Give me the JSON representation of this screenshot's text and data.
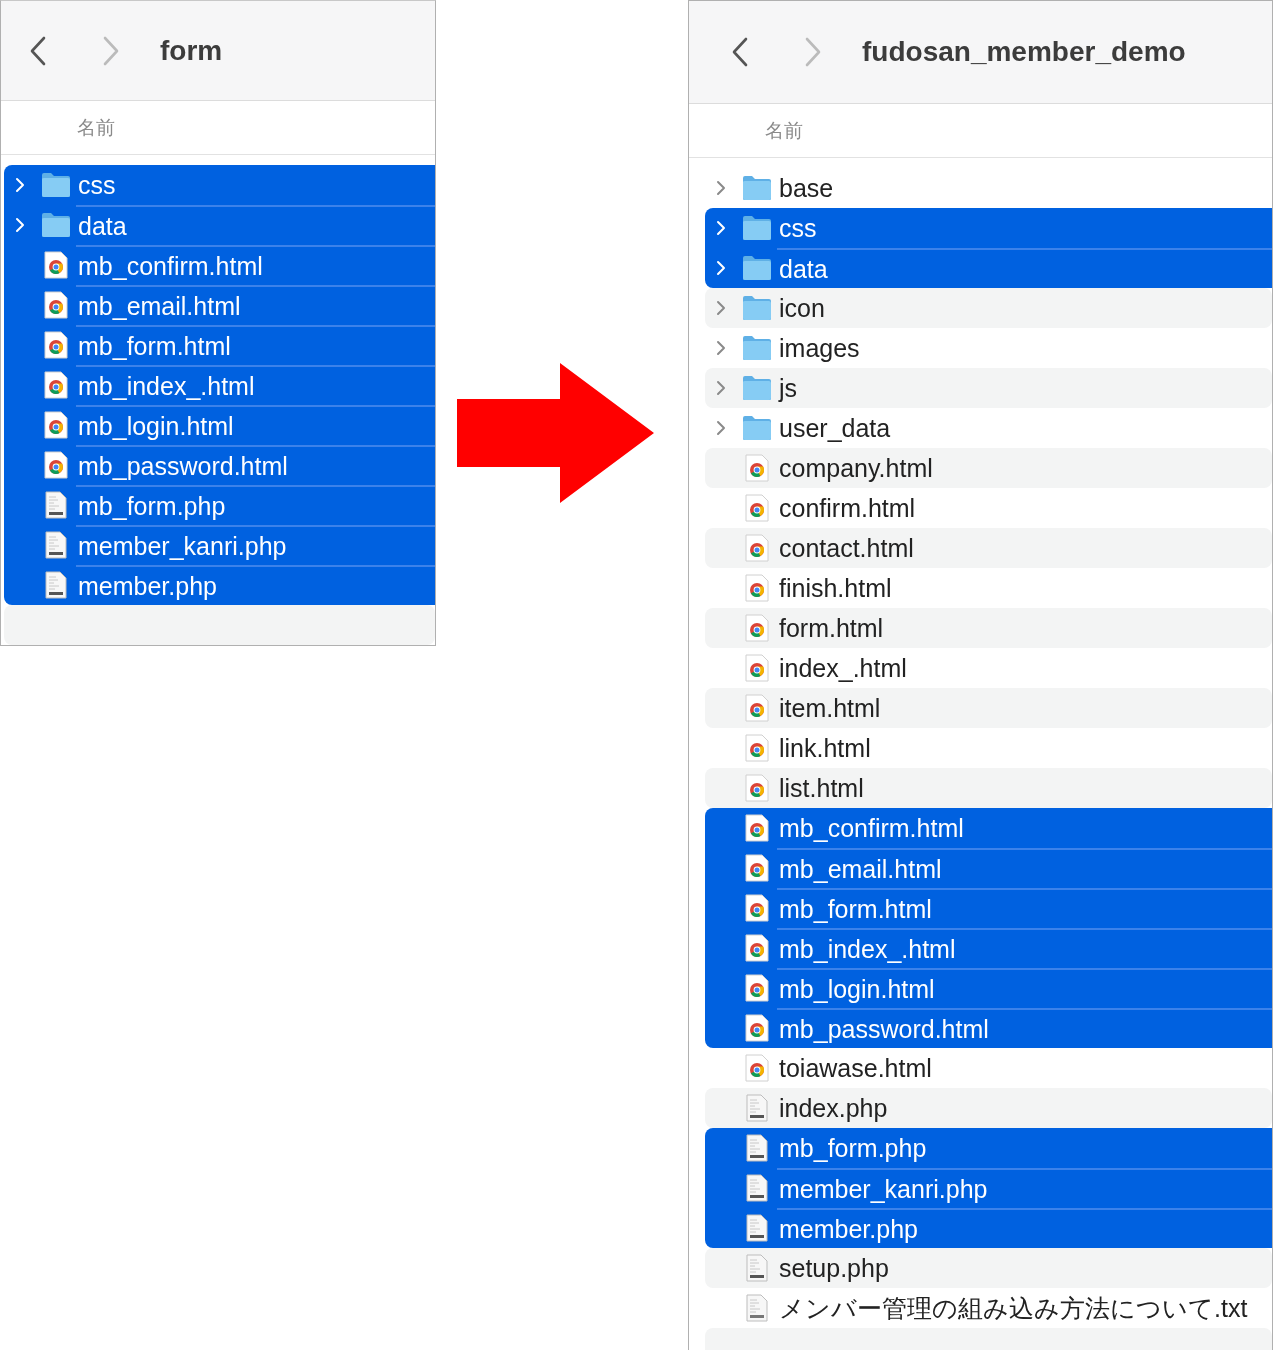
{
  "windows": [
    {
      "title": "form",
      "back_disabled": false,
      "forward_disabled": true,
      "column_header": "名前",
      "items": [
        {
          "name": "css",
          "kind": "folder",
          "selected": true
        },
        {
          "name": "data",
          "kind": "folder",
          "selected": true
        },
        {
          "name": "mb_confirm.html",
          "kind": "html",
          "selected": true
        },
        {
          "name": "mb_email.html",
          "kind": "html",
          "selected": true
        },
        {
          "name": "mb_form.html",
          "kind": "html",
          "selected": true
        },
        {
          "name": "mb_index_.html",
          "kind": "html",
          "selected": true
        },
        {
          "name": "mb_login.html",
          "kind": "html",
          "selected": true
        },
        {
          "name": "mb_password.html",
          "kind": "html",
          "selected": true
        },
        {
          "name": "mb_form.php",
          "kind": "php",
          "selected": true
        },
        {
          "name": "member_kanri.php",
          "kind": "php",
          "selected": true
        },
        {
          "name": "member.php",
          "kind": "php",
          "selected": true
        }
      ]
    },
    {
      "title": "fudosan_member_demo",
      "back_disabled": false,
      "forward_disabled": true,
      "column_header": "名前",
      "items": [
        {
          "name": "base",
          "kind": "folder",
          "selected": false
        },
        {
          "name": "css",
          "kind": "folder",
          "selected": true
        },
        {
          "name": "data",
          "kind": "folder",
          "selected": true
        },
        {
          "name": "icon",
          "kind": "folder",
          "selected": false
        },
        {
          "name": "images",
          "kind": "folder",
          "selected": false
        },
        {
          "name": "js",
          "kind": "folder",
          "selected": false
        },
        {
          "name": "user_data",
          "kind": "folder",
          "selected": false
        },
        {
          "name": "company.html",
          "kind": "html",
          "selected": false
        },
        {
          "name": "confirm.html",
          "kind": "html",
          "selected": false
        },
        {
          "name": "contact.html",
          "kind": "html",
          "selected": false
        },
        {
          "name": "finish.html",
          "kind": "html",
          "selected": false
        },
        {
          "name": "form.html",
          "kind": "html",
          "selected": false
        },
        {
          "name": "index_.html",
          "kind": "html",
          "selected": false
        },
        {
          "name": "item.html",
          "kind": "html",
          "selected": false
        },
        {
          "name": "link.html",
          "kind": "html",
          "selected": false
        },
        {
          "name": "list.html",
          "kind": "html",
          "selected": false
        },
        {
          "name": "mb_confirm.html",
          "kind": "html",
          "selected": true
        },
        {
          "name": "mb_email.html",
          "kind": "html",
          "selected": true
        },
        {
          "name": "mb_form.html",
          "kind": "html",
          "selected": true
        },
        {
          "name": "mb_index_.html",
          "kind": "html",
          "selected": true
        },
        {
          "name": "mb_login.html",
          "kind": "html",
          "selected": true
        },
        {
          "name": "mb_password.html",
          "kind": "html",
          "selected": true
        },
        {
          "name": "toiawase.html",
          "kind": "html",
          "selected": false
        },
        {
          "name": "index.php",
          "kind": "php",
          "selected": false
        },
        {
          "name": "mb_form.php",
          "kind": "php",
          "selected": true
        },
        {
          "name": "member_kanri.php",
          "kind": "php",
          "selected": true
        },
        {
          "name": "member.php",
          "kind": "php",
          "selected": true
        },
        {
          "name": "setup.php",
          "kind": "php",
          "selected": false
        },
        {
          "name": "メンバー管理の組み込み方法について.txt",
          "kind": "txt",
          "selected": false
        }
      ]
    }
  ]
}
